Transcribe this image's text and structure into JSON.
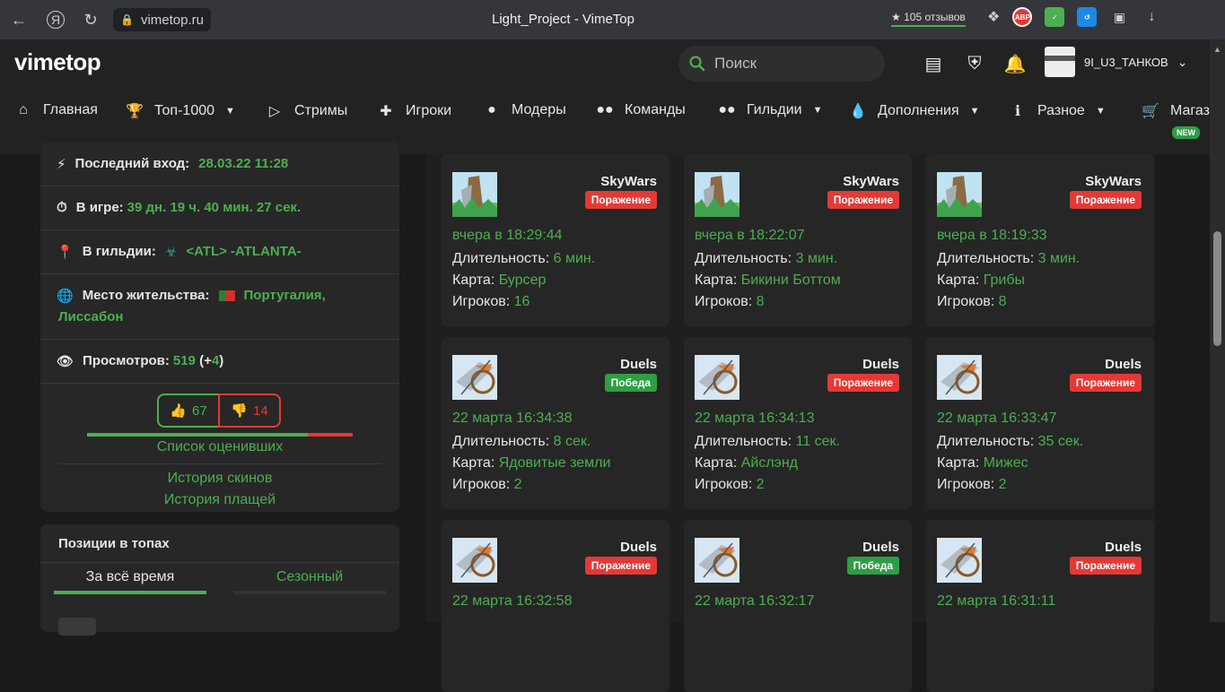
{
  "browser": {
    "url": "vimetop.ru",
    "tab_title": "Light_Project - VimeTop",
    "reviews": "105 отзывов",
    "abp_label": "ABP"
  },
  "header": {
    "logo": "vimetop",
    "search_placeholder": "Поиск",
    "username": "9I_U3_ТАНКОВ"
  },
  "menu": [
    {
      "label": "Главная",
      "icon": "home-icon"
    },
    {
      "label": "Топ-1000",
      "icon": "trophy-icon"
    },
    {
      "label": "Стримы",
      "icon": "video-icon"
    },
    {
      "label": "Игроки",
      "icon": "user-plus-icon"
    },
    {
      "label": "Модеры",
      "icon": "user-shield-icon"
    },
    {
      "label": "Команды",
      "icon": "users-icon"
    },
    {
      "label": "Гильдии",
      "icon": "guild-icon"
    },
    {
      "label": "Дополнения",
      "icon": "drop-icon"
    },
    {
      "label": "Разное",
      "icon": "info-icon"
    },
    {
      "label": "Магаз",
      "icon": "cart-icon"
    }
  ],
  "new_badge": "NEW",
  "profile": {
    "last_login_label": "Последний вход:",
    "last_login_value": "28.03.22 11:28",
    "ingame_label": "В игре:",
    "ingame_value": "39 дн. 19 ч. 40 мин. 27 сек.",
    "guild_label": "В гильдии:",
    "guild_value": "<ATL> -ATLANTA-",
    "residence_label": "Место жительства:",
    "residence_value_1": "Португалия,",
    "residence_value_2": "Лиссабон",
    "views_label": "Просмотров:",
    "views_value": "519",
    "views_open": "(+",
    "views_delta": "4",
    "views_close": ")",
    "likes": "67",
    "dislikes": "14",
    "like_ratio": 0.83,
    "raters_link": "Список оценивших",
    "skins_link": "История скинов",
    "capes_link": "История плащей"
  },
  "tops": {
    "title": "Позиции в топах",
    "tab_all": "За всё время",
    "tab_season": "Сезонный"
  },
  "labels": {
    "duration": "Длительность:",
    "map": "Карта:",
    "players": "Игроков:"
  },
  "matches": [
    {
      "mode": "SkyWars",
      "result": "Поражение",
      "date": "вчера в 18:29:44",
      "duration": "6 мин.",
      "map": "Бурсер",
      "players": "16"
    },
    {
      "mode": "SkyWars",
      "result": "Поражение",
      "date": "вчера в 18:22:07",
      "duration": "3 мин.",
      "map": "Бикини Боттом",
      "players": "8"
    },
    {
      "mode": "SkyWars",
      "result": "Поражение",
      "date": "вчера в 18:19:33",
      "duration": "3 мин.",
      "map": "Грибы",
      "players": "8"
    },
    {
      "mode": "Duels",
      "result": "Победа",
      "date": "22 марта 16:34:38",
      "duration": "8 сек.",
      "map": "Ядовитые земли",
      "players": "2"
    },
    {
      "mode": "Duels",
      "result": "Поражение",
      "date": "22 марта 16:34:13",
      "duration": "11 сек.",
      "map": "Айслэнд",
      "players": "2"
    },
    {
      "mode": "Duels",
      "result": "Поражение",
      "date": "22 марта 16:33:47",
      "duration": "35 сек.",
      "map": "Мижес",
      "players": "2"
    },
    {
      "mode": "Duels",
      "result": "Поражение",
      "date": "22 марта 16:32:58"
    },
    {
      "mode": "Duels",
      "result": "Победа",
      "date": "22 марта 16:32:17"
    },
    {
      "mode": "Duels",
      "result": "Поражение",
      "date": "22 марта 16:31:11"
    }
  ],
  "colors": {
    "accent_green": "#4caf50",
    "loss_red": "#e53935",
    "win_green": "#2e9e44"
  }
}
